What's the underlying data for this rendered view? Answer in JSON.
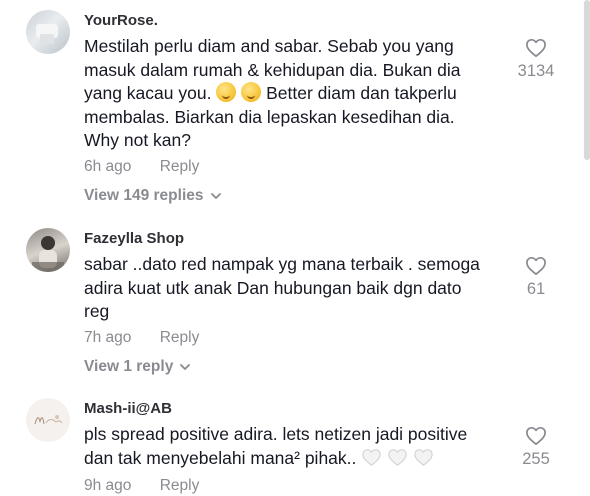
{
  "comments": [
    {
      "username": "YourRose.",
      "text_lines": [
        "Mestilah perlu diam and sabar. Sebab you yang",
        "masuk dalam rumah & kehidupan dia. Bukan dia",
        "yang kacau you.",
        "Better diam dan takperlu",
        "membalas. Biarkan dia lepaskan kesedihan dia.",
        "Why not kan?"
      ],
      "time": "6h ago",
      "reply_label": "Reply",
      "view_replies": "View 149 replies",
      "likes": "3134"
    },
    {
      "username": "Fazeylla Shop",
      "text_lines": [
        "sabar ..dato red nampak yg mana terbaik . semoga",
        "adira kuat utk anak Dan hubungan baik dgn dato",
        "reg"
      ],
      "time": "7h ago",
      "reply_label": "Reply",
      "view_replies": "View 1 reply",
      "likes": "61"
    },
    {
      "username": "Mash-ii@AB",
      "text_lines": [
        "pls spread positive adira. lets netizen jadi positive",
        "dan tak menyebelahi mana² pihak.."
      ],
      "time": "9h ago",
      "reply_label": "Reply",
      "likes": "255"
    }
  ],
  "icons": {
    "like": "heart-outline-icon",
    "expand": "chevron-down-icon",
    "emoji": "face-emoji-icon",
    "white_heart": "white-heart-emoji-icon"
  },
  "colors": {
    "text_primary": "#161823",
    "text_secondary": "#8a8b91"
  }
}
